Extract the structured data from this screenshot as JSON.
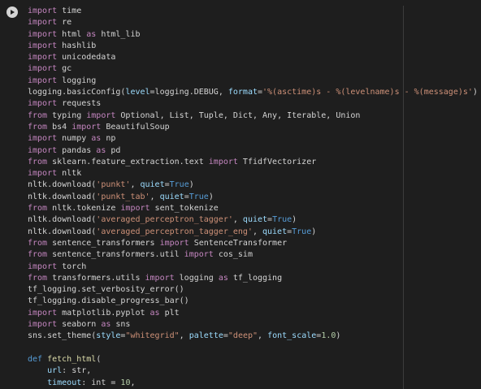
{
  "editor": {
    "colors": {
      "background": "#1e1e1e",
      "keyword": "#c586c0",
      "function": "#dcdcaa",
      "string": "#ce9178",
      "constant": "#569cd6",
      "number": "#b5cea8",
      "parameter": "#9cdcfe",
      "plain": "#d4d4d4"
    },
    "run_button_icon": "play-icon",
    "lines": [
      [
        [
          "kw",
          "import"
        ],
        [
          "plain",
          " time"
        ]
      ],
      [
        [
          "kw",
          "import"
        ],
        [
          "plain",
          " re"
        ]
      ],
      [
        [
          "kw",
          "import"
        ],
        [
          "plain",
          " html "
        ],
        [
          "kw",
          "as"
        ],
        [
          "plain",
          " html_lib"
        ]
      ],
      [
        [
          "kw",
          "import"
        ],
        [
          "plain",
          " hashlib"
        ]
      ],
      [
        [
          "kw",
          "import"
        ],
        [
          "plain",
          " unicodedata"
        ]
      ],
      [
        [
          "kw",
          "import"
        ],
        [
          "plain",
          " gc"
        ]
      ],
      [
        [
          "kw",
          "import"
        ],
        [
          "plain",
          " logging"
        ]
      ],
      [
        [
          "plain",
          "logging.basicConfig("
        ],
        [
          "param",
          "level"
        ],
        [
          "plain",
          "=logging.DEBUG, "
        ],
        [
          "param",
          "format"
        ],
        [
          "plain",
          "="
        ],
        [
          "str",
          "'%(asctime)s - %(levelname)s - %(message)s'"
        ],
        [
          "plain",
          ")"
        ]
      ],
      [
        [
          "kw",
          "import"
        ],
        [
          "plain",
          " requests"
        ]
      ],
      [
        [
          "kw",
          "from"
        ],
        [
          "plain",
          " typing "
        ],
        [
          "kw",
          "import"
        ],
        [
          "plain",
          " Optional, List, Tuple, Dict, Any, Iterable, Union"
        ]
      ],
      [
        [
          "kw",
          "from"
        ],
        [
          "plain",
          " bs4 "
        ],
        [
          "kw",
          "import"
        ],
        [
          "plain",
          " BeautifulSoup"
        ]
      ],
      [
        [
          "kw",
          "import"
        ],
        [
          "plain",
          " numpy "
        ],
        [
          "kw",
          "as"
        ],
        [
          "plain",
          " np"
        ]
      ],
      [
        [
          "kw",
          "import"
        ],
        [
          "plain",
          " pandas "
        ],
        [
          "kw",
          "as"
        ],
        [
          "plain",
          " pd"
        ]
      ],
      [
        [
          "kw",
          "from"
        ],
        [
          "plain",
          " sklearn.feature_extraction.text "
        ],
        [
          "kw",
          "import"
        ],
        [
          "plain",
          " TfidfVectorizer"
        ]
      ],
      [
        [
          "kw",
          "import"
        ],
        [
          "plain",
          " nltk"
        ]
      ],
      [
        [
          "plain",
          "nltk.download("
        ],
        [
          "str",
          "'punkt'"
        ],
        [
          "plain",
          ", "
        ],
        [
          "param",
          "quiet"
        ],
        [
          "plain",
          "="
        ],
        [
          "const",
          "True"
        ],
        [
          "plain",
          ")"
        ]
      ],
      [
        [
          "plain",
          "nltk.download("
        ],
        [
          "str",
          "'punkt_tab'"
        ],
        [
          "plain",
          ", "
        ],
        [
          "param",
          "quiet"
        ],
        [
          "plain",
          "="
        ],
        [
          "const",
          "True"
        ],
        [
          "plain",
          ")"
        ]
      ],
      [
        [
          "kw",
          "from"
        ],
        [
          "plain",
          " nltk.tokenize "
        ],
        [
          "kw",
          "import"
        ],
        [
          "plain",
          " sent_tokenize"
        ]
      ],
      [
        [
          "plain",
          "nltk.download("
        ],
        [
          "str",
          "'averaged_perceptron_tagger'"
        ],
        [
          "plain",
          ", "
        ],
        [
          "param",
          "quiet"
        ],
        [
          "plain",
          "="
        ],
        [
          "const",
          "True"
        ],
        [
          "plain",
          ")"
        ]
      ],
      [
        [
          "plain",
          "nltk.download("
        ],
        [
          "str",
          "'averaged_perceptron_tagger_eng'"
        ],
        [
          "plain",
          ", "
        ],
        [
          "param",
          "quiet"
        ],
        [
          "plain",
          "="
        ],
        [
          "const",
          "True"
        ],
        [
          "plain",
          ")"
        ]
      ],
      [
        [
          "kw",
          "from"
        ],
        [
          "plain",
          " sentence_transformers "
        ],
        [
          "kw",
          "import"
        ],
        [
          "plain",
          " SentenceTransformer"
        ]
      ],
      [
        [
          "kw",
          "from"
        ],
        [
          "plain",
          " sentence_transformers.util "
        ],
        [
          "kw",
          "import"
        ],
        [
          "plain",
          " cos_sim"
        ]
      ],
      [
        [
          "kw",
          "import"
        ],
        [
          "plain",
          " torch"
        ]
      ],
      [
        [
          "kw",
          "from"
        ],
        [
          "plain",
          " transformers.utils "
        ],
        [
          "kw",
          "import"
        ],
        [
          "plain",
          " logging "
        ],
        [
          "kw",
          "as"
        ],
        [
          "plain",
          " tf_logging"
        ]
      ],
      [
        [
          "plain",
          "tf_logging.set_verbosity_error()"
        ]
      ],
      [
        [
          "plain",
          "tf_logging.disable_progress_bar()"
        ]
      ],
      [
        [
          "kw",
          "import"
        ],
        [
          "plain",
          " matplotlib.pyplot "
        ],
        [
          "kw",
          "as"
        ],
        [
          "plain",
          " plt"
        ]
      ],
      [
        [
          "kw",
          "import"
        ],
        [
          "plain",
          " seaborn "
        ],
        [
          "kw",
          "as"
        ],
        [
          "plain",
          " sns"
        ]
      ],
      [
        [
          "plain",
          "sns.set_theme("
        ],
        [
          "param",
          "style"
        ],
        [
          "plain",
          "="
        ],
        [
          "str",
          "\"whitegrid\""
        ],
        [
          "plain",
          ", "
        ],
        [
          "param",
          "palette"
        ],
        [
          "plain",
          "="
        ],
        [
          "str",
          "\"deep\""
        ],
        [
          "plain",
          ", "
        ],
        [
          "param",
          "font_scale"
        ],
        [
          "plain",
          "="
        ],
        [
          "num",
          "1.0"
        ],
        [
          "plain",
          ")"
        ]
      ],
      [
        [
          "plain",
          ""
        ]
      ],
      [
        [
          "def",
          "def"
        ],
        [
          "plain",
          " "
        ],
        [
          "fn",
          "fetch_html"
        ],
        [
          "plain",
          "("
        ]
      ],
      [
        [
          "plain",
          "    "
        ],
        [
          "param",
          "url"
        ],
        [
          "plain",
          ": str,"
        ]
      ],
      [
        [
          "plain",
          "    "
        ],
        [
          "param",
          "timeout"
        ],
        [
          "plain",
          ": int = "
        ],
        [
          "num",
          "10"
        ],
        [
          "plain",
          ","
        ]
      ]
    ]
  }
}
